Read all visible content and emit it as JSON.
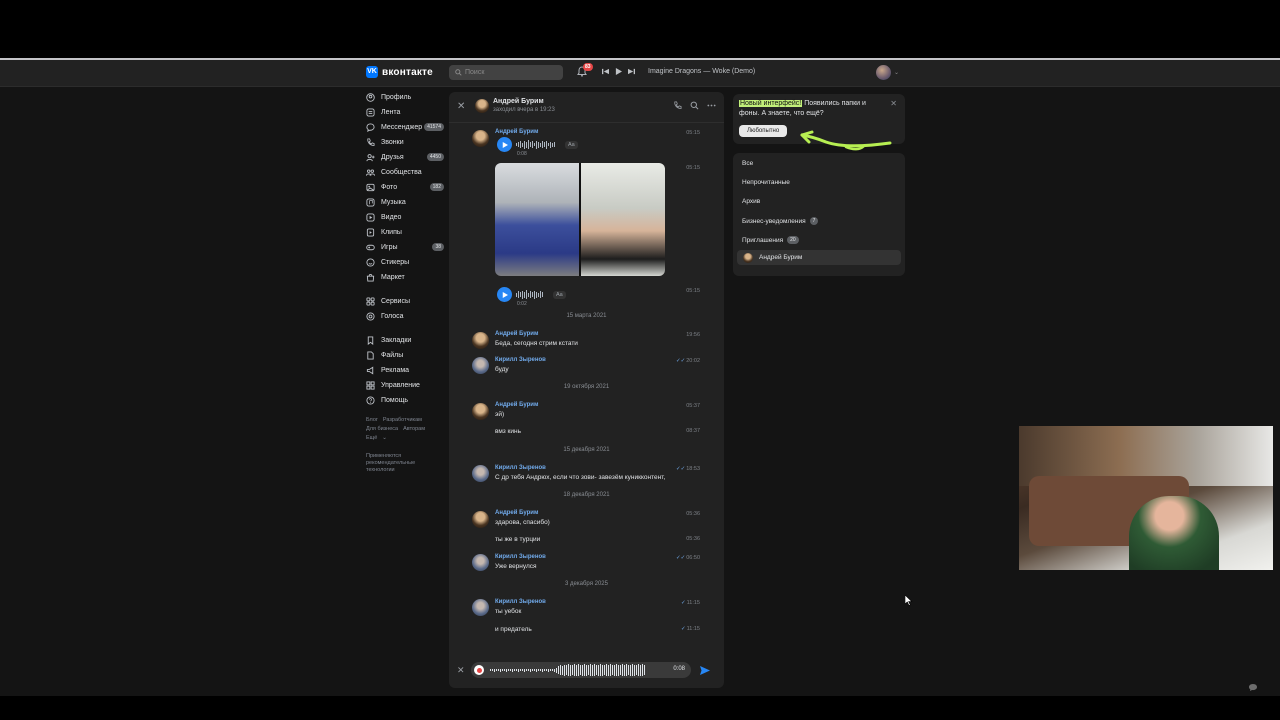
{
  "header": {
    "logo": "вконтакте",
    "search_placeholder": "Поиск",
    "notifications": "83",
    "track": "Imagine Dragons — Woke (Demo)"
  },
  "sidebar": {
    "items": [
      {
        "label": "Профиль",
        "icon": "user-circle-icon"
      },
      {
        "label": "Лента",
        "icon": "feed-icon"
      },
      {
        "label": "Мессенджер",
        "icon": "chat-icon",
        "count": "41574"
      },
      {
        "label": "Звонки",
        "icon": "phone-icon"
      },
      {
        "label": "Друзья",
        "icon": "friends-icon",
        "count": "4450"
      },
      {
        "label": "Сообщества",
        "icon": "communities-icon"
      },
      {
        "label": "Фото",
        "icon": "photo-icon",
        "count": "182"
      },
      {
        "label": "Музыка",
        "icon": "music-icon"
      },
      {
        "label": "Видео",
        "icon": "video-icon"
      },
      {
        "label": "Клипы",
        "icon": "clips-icon"
      },
      {
        "label": "Игры",
        "icon": "games-icon",
        "count": "38"
      },
      {
        "label": "Стикеры",
        "icon": "sticker-icon"
      },
      {
        "label": "Маркет",
        "icon": "market-icon"
      }
    ],
    "items2": [
      {
        "label": "Сервисы",
        "icon": "services-icon"
      },
      {
        "label": "Голоса",
        "icon": "votes-icon"
      }
    ],
    "items3": [
      {
        "label": "Закладки",
        "icon": "bookmark-icon"
      },
      {
        "label": "Файлы",
        "icon": "files-icon"
      },
      {
        "label": "Реклама",
        "icon": "ads-icon"
      },
      {
        "label": "Управление",
        "icon": "manage-icon"
      },
      {
        "label": "Помощь",
        "icon": "help-icon"
      }
    ],
    "footer_links": [
      "Блог",
      "Разработчикам",
      "Для бизнеса",
      "Авторам",
      "Ещё"
    ],
    "footer_note": "Применяются рекомендательные технологии"
  },
  "chat": {
    "name": "Андрей Бурим",
    "status": "заходил вчера в 19:23",
    "msgs": {
      "m1": {
        "author": "Андрей Бурим",
        "time": "05:15",
        "voice_dur": "0:08",
        "aa": "Aa"
      },
      "m2": {
        "time": "05:15"
      },
      "m3": {
        "time": "05:15",
        "voice_dur": "0:02",
        "aa": "Aa"
      },
      "d1": "15 марта 2021",
      "m4": {
        "author": "Андрей Бурим",
        "text": "Беда, сегодня стрим кстати",
        "time": "19:56"
      },
      "m5": {
        "author": "Кирилл Зыренов",
        "text": "буду",
        "time": "20:02"
      },
      "d2": "19 октября 2021",
      "m6": {
        "author": "Андрей Бурим",
        "text": "эй)",
        "time": "05:37"
      },
      "m7": {
        "text": "вмз кинь",
        "time": "08:37"
      },
      "d3": "15 декабря 2021",
      "m8": {
        "author": "Кирилл Зыренов",
        "text": "С др тебя Андрюх, если что зови- завезём куникконтент,",
        "time": "18:53"
      },
      "d4": "18 декабря 2021",
      "m9": {
        "author": "Андрей Бурим",
        "text": "здарова, спасибо)",
        "time": "05:36"
      },
      "m10": {
        "text": "ты же в турции",
        "time": "05:36"
      },
      "m11": {
        "author": "Кирилл Зыренов",
        "text": "Уже вернулся",
        "time": "06:50"
      },
      "d5": "3 декабря 2025",
      "m12": {
        "author": "Кирилл Зыренов",
        "text": "ты уебок",
        "time": "11:15"
      },
      "m13": {
        "text": "и предатель",
        "time": "11:15"
      }
    },
    "recording_time": "0:08"
  },
  "promo": {
    "highlight": "Новый интерфейс!",
    "text": " Появились папки и фоны. А знаете, что ещё?",
    "button": "Любопытно"
  },
  "folders": {
    "all": "Все",
    "unread": "Непрочитанные",
    "archive": "Архив",
    "business": "Бизнес-уведомления",
    "business_count": "7",
    "invites": "Приглашения",
    "invites_count": "20",
    "selected": "Андрей Бурим"
  },
  "colors": {
    "accent": "#2787f5",
    "link": "#71aaeb",
    "highlight": "#c2f07a",
    "badge": "#e64646"
  }
}
